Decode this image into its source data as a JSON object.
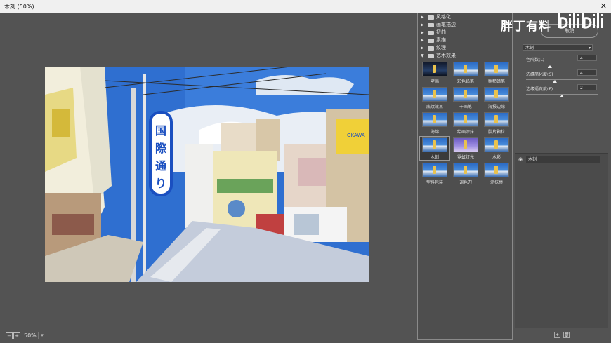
{
  "window": {
    "title": "木刻 (50%)",
    "close": "✕"
  },
  "canvas": {
    "zoom": "50%"
  },
  "photo": {
    "sign_text": "国際通り",
    "shop_sign": "OKAWA"
  },
  "gallery": {
    "categories": [
      {
        "label": "风格化",
        "expanded": false
      },
      {
        "label": "画笔描边",
        "expanded": false
      },
      {
        "label": "扭曲",
        "expanded": false
      },
      {
        "label": "素描",
        "expanded": false
      },
      {
        "label": "纹理",
        "expanded": false
      },
      {
        "label": "艺术效果",
        "expanded": true
      }
    ],
    "filters": [
      {
        "label": "壁画",
        "style": "dark"
      },
      {
        "label": "彩色铅笔",
        "style": "normal"
      },
      {
        "label": "粗糙蜡笔",
        "style": "normal"
      },
      {
        "label": "底纹效果",
        "style": "normal"
      },
      {
        "label": "干画笔",
        "style": "normal"
      },
      {
        "label": "海报边缘",
        "style": "normal"
      },
      {
        "label": "海绵",
        "style": "normal"
      },
      {
        "label": "绘画涂抹",
        "style": "normal"
      },
      {
        "label": "胶片颗粒",
        "style": "normal"
      },
      {
        "label": "木刻",
        "style": "normal",
        "selected": true
      },
      {
        "label": "霓虹灯光",
        "style": "purple"
      },
      {
        "label": "水彩",
        "style": "normal"
      },
      {
        "label": "塑料包装",
        "style": "normal"
      },
      {
        "label": "调色刀",
        "style": "normal"
      },
      {
        "label": "涂抹棒",
        "style": "normal"
      }
    ]
  },
  "settings": {
    "cancel": "取消",
    "filter_select": "木刻",
    "params": [
      {
        "label": "色阶数(L)",
        "value": "4",
        "level": 0.33
      },
      {
        "label": "边缘简化度(S)",
        "value": "4",
        "level": 0.4
      },
      {
        "label": "边缘逼真度(F)",
        "value": "2",
        "level": 0.5
      }
    ]
  },
  "layers": {
    "items": [
      {
        "name": "木刻"
      }
    ]
  },
  "watermark": {
    "text": "胖丁有料",
    "logo": "bilibili"
  }
}
